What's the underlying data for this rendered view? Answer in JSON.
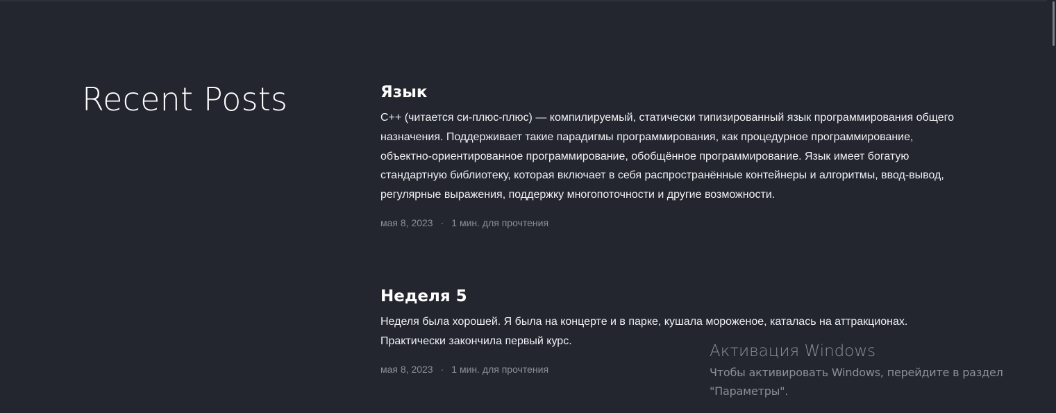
{
  "section": {
    "title": "Recent Posts"
  },
  "posts": [
    {
      "title": "Язык",
      "text": "C++ (читается си-плюс-плюс) — компилируемый, статически типизированный язык программирования общего назначения. Поддерживает такие парадигмы программирования, как процедурное программирование, объектно-ориентированное программирование, обобщённое программирование. Язык имеет богатую стандартную библиотеку, которая включает в себя распространённые контейнеры и алгоритмы, ввод-вывод, регулярные выражения, поддержку многопоточности и другие возможности.",
      "date": "мая 8, 2023",
      "separator": "·",
      "reading_time": "1 мин. для прочтения"
    },
    {
      "title": "Неделя 5",
      "text": "Неделя была хорошей. Я была на концерте и в парке, кушала мороженое, каталась на аттракционах. Практически закончила первый курс.",
      "date": "мая 8, 2023",
      "separator": "·",
      "reading_time": "1 мин. для прочтения"
    }
  ],
  "windows_watermark": {
    "title": "Активация Windows",
    "line1": "Чтобы активировать Windows, перейдите в раздел",
    "line2": "\"Параметры\"."
  }
}
